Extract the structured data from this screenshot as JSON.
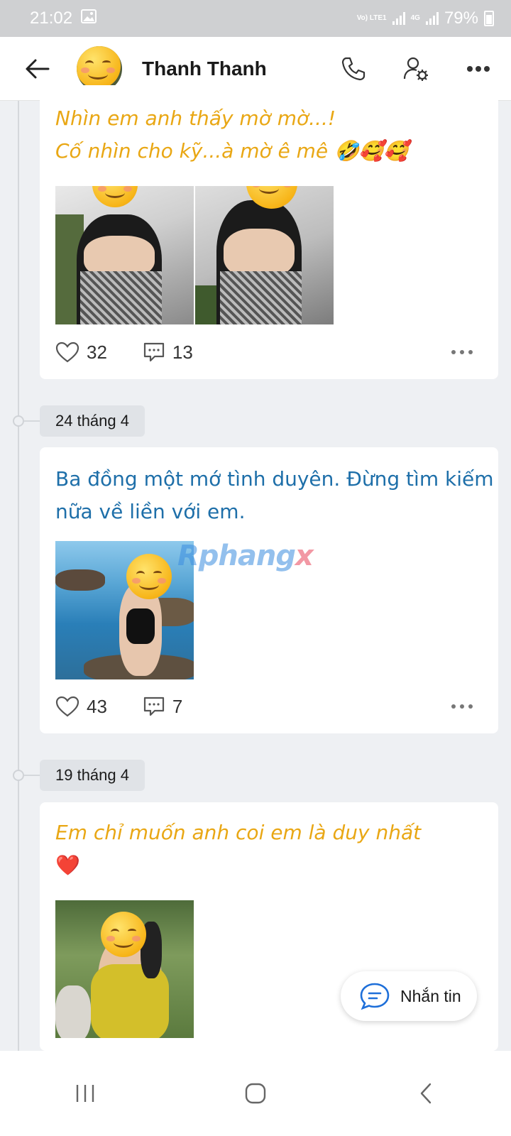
{
  "status_bar": {
    "time": "21:02",
    "battery": "79%",
    "net1": "Vo) LTE1",
    "net2": "4G"
  },
  "header": {
    "title": "Thanh Thanh"
  },
  "posts": [
    {
      "lines": [
        "Nhìn em anh thấy mờ mờ...!",
        "Cố nhìn cho kỹ...à mờ ê mê 🤣🥰🥰"
      ],
      "likes": "32",
      "comments": "13"
    },
    {
      "date": "24 tháng 4",
      "lines": [
        "Ba đồng một mớ tình duyên. Đừng tìm kiếm",
        "nữa về liền với em."
      ],
      "likes": "43",
      "comments": "7"
    },
    {
      "date": "19 tháng 4",
      "lines": [
        "Em chỉ muốn anh coi em là duy nhất",
        "❤️"
      ]
    }
  ],
  "watermark": {
    "main": "Rphang",
    "accent": "x"
  },
  "message_button": {
    "label": "Nhắn tin"
  },
  "colors": {
    "gold_text": "#e9a714",
    "blue_text": "#1e6fa9",
    "background": "#eef0f3"
  }
}
